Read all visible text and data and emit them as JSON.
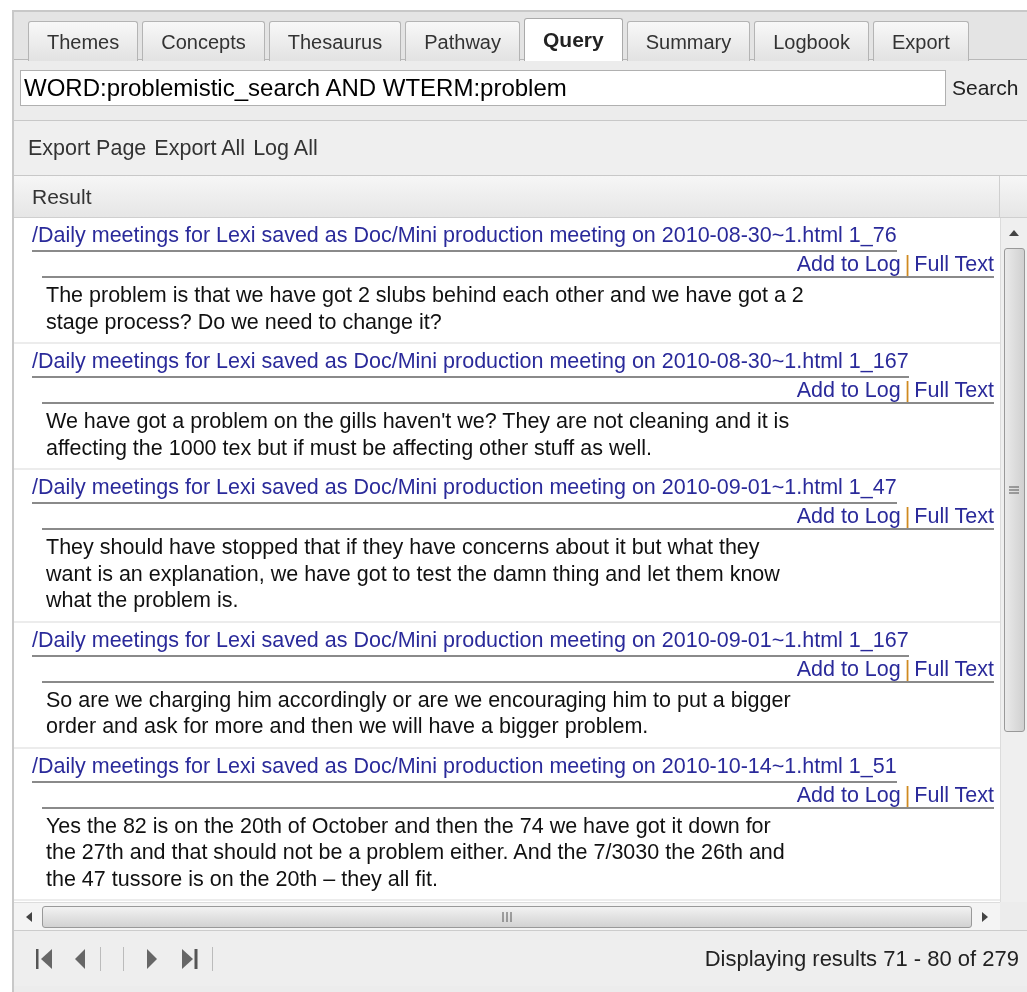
{
  "tabs": [
    {
      "label": "Themes",
      "selected": false
    },
    {
      "label": "Concepts",
      "selected": false
    },
    {
      "label": "Thesaurus",
      "selected": false
    },
    {
      "label": "Pathway",
      "selected": false
    },
    {
      "label": "Query",
      "selected": true
    },
    {
      "label": "Summary",
      "selected": false
    },
    {
      "label": "Logbook",
      "selected": false
    },
    {
      "label": "Export",
      "selected": false
    }
  ],
  "search": {
    "value": "WORD:problemistic_search AND WTERM:problem",
    "button": "Search"
  },
  "toolbar": [
    "Export Page",
    "Export All",
    "Log All"
  ],
  "table": {
    "columns": [
      "Result"
    ],
    "rows": [
      {
        "title": "/Daily meetings for Lexi saved as Doc/Mini production meeting on 2010-08-30~1.html 1_76",
        "actions": [
          "Add to Log",
          "Full Text"
        ],
        "action_separator": "|",
        "text": "The problem is that we have got 2 slubs behind each other and we have got a 2 stage process? Do we need to change it?"
      },
      {
        "title": "/Daily meetings for Lexi saved as Doc/Mini production meeting on 2010-08-30~1.html 1_167",
        "actions": [
          "Add to Log",
          "Full Text"
        ],
        "action_separator": "|",
        "text": "We have got a problem on the gills haven't we? They are not cleaning and it is affecting the 1000 tex but if must be affecting other stuff as well."
      },
      {
        "title": "/Daily meetings for Lexi saved as Doc/Mini production meeting on 2010-09-01~1.html 1_47",
        "actions": [
          "Add to Log",
          "Full Text"
        ],
        "action_separator": "|",
        "text": "They should have stopped that if they have concerns about it but what they want is an explanation, we have got to test the damn thing and let them know what the problem is."
      },
      {
        "title": "/Daily meetings for Lexi saved as Doc/Mini production meeting on 2010-09-01~1.html 1_167",
        "actions": [
          "Add to Log",
          "Full Text"
        ],
        "action_separator": "|",
        "text": "So are we charging him accordingly or are we encouraging him to put a bigger order and ask for more and then we will have a bigger problem."
      },
      {
        "title": "/Daily meetings for Lexi saved as Doc/Mini production meeting on 2010-10-14~1.html 1_51",
        "actions": [
          "Add to Log",
          "Full Text"
        ],
        "action_separator": "|",
        "text": "Yes the 82 is on the 20th of October and then the 74 we have got it down for the 27th and that should not be a problem either. And the 7/3030 the 26th and the 47 tussore is on the 20th – they all fit."
      }
    ]
  },
  "status": "Displaying results 71 - 80 of 279"
}
